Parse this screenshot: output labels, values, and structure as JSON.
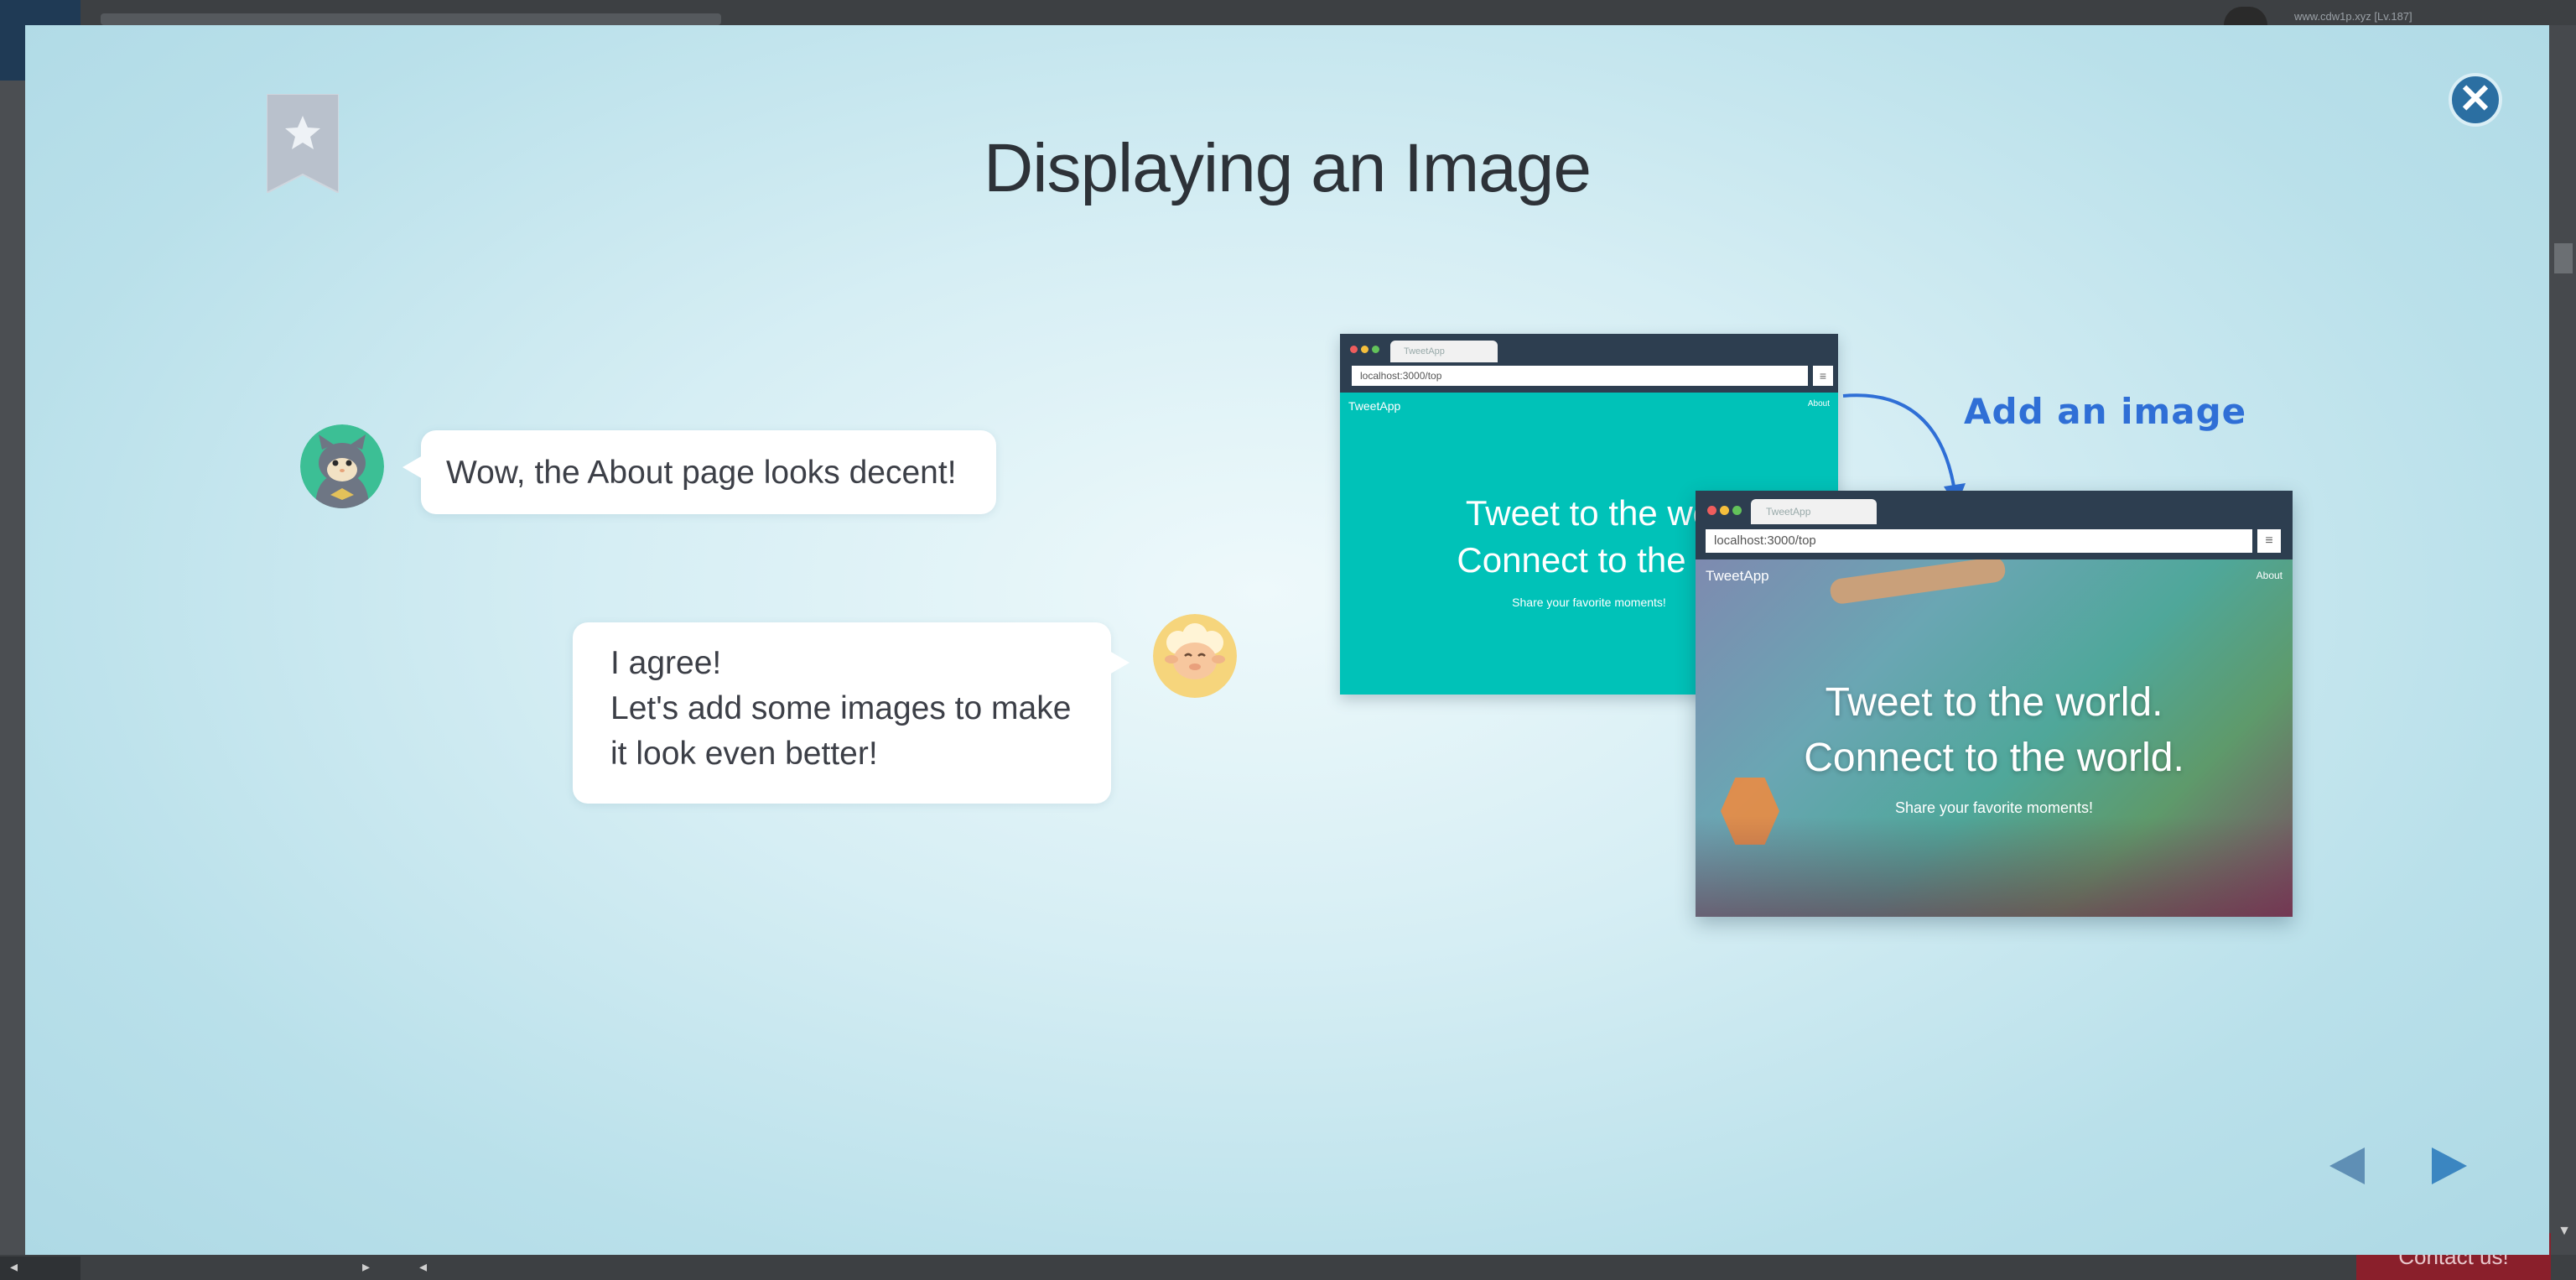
{
  "background": {
    "user_text": "www.cdw1p.xyz [Lv.187]",
    "contact_label": "Contact us!"
  },
  "modal": {
    "title": "Displaying an Image",
    "close_icon": "close-icon",
    "bookmark_icon": "bookmark-star-icon",
    "nav": {
      "prev_icon": "triangle-left-icon",
      "next_icon": "triangle-right-icon"
    }
  },
  "chat": [
    {
      "speaker": "cat",
      "text": "Wow, the About page looks decent!"
    },
    {
      "speaker": "sheep",
      "lines": [
        "I agree!",
        "Let's add some images to make",
        "it look even better!"
      ]
    }
  ],
  "illustration": {
    "annotation": "Add an image",
    "before": {
      "tab_label": "TweetApp",
      "url": "localhost:3000/top",
      "brand": "TweetApp",
      "nav_link": "About",
      "hero_line1": "Tweet to the wo",
      "hero_line2": "Connect to the w",
      "subtitle": "Share your favorite moments!"
    },
    "after": {
      "tab_label": "TweetApp",
      "url": "localhost:3000/top",
      "brand": "TweetApp",
      "nav_link": "About",
      "hero_line1": "Tweet to the world.",
      "hero_line2": "Connect to the world.",
      "subtitle": "Share your favorite moments!"
    }
  },
  "colors": {
    "accent": "#2b6fa2",
    "teal_hero": "#00c2b8",
    "annotation_blue": "#2f6fd6"
  }
}
